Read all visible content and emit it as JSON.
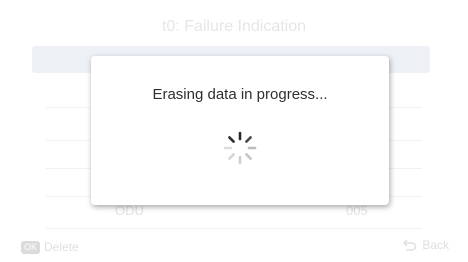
{
  "screen": {
    "title": "t0: Failure Indication",
    "row": {
      "name": "ODU",
      "code": "005"
    }
  },
  "footer": {
    "ok_badge": "OK",
    "delete_label": "Delete",
    "back_label": "Back"
  },
  "dialog": {
    "message": "Erasing data in progress...",
    "spinner_icon": "spinner-icon"
  }
}
